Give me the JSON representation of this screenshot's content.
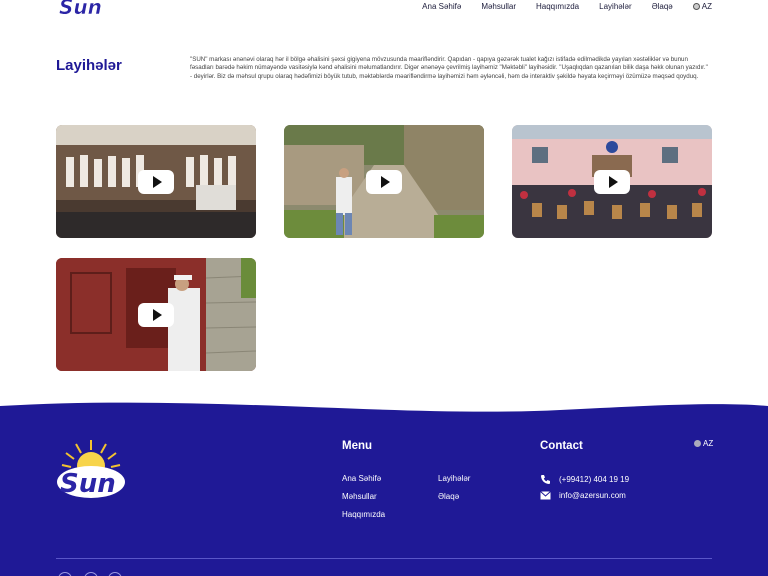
{
  "header": {
    "nav": [
      "Ana Səhifə",
      "Məhsullar",
      "Haqqımızda",
      "Layihələr",
      "Əlaqə"
    ],
    "lang": "AZ"
  },
  "main": {
    "title": "Layihələr",
    "intro": "\"SUN\" markası ənənəvi olaraq hər il bölgə əhalisini şəxsi gigiyena mövzusunda məarifləndirir. Qapıdan - qapıya gəzərək tualet kağızı istifadə edilmədikdə yayılan xəstəliklər və bunun fəsadları barədə həkim nümayəndə vasitəsiylə kənd əhalisini məlumatlandırır. Digər ənənəyə çevrilmiş layihəmiz \"Məktəbli\" layihəsidir. \"Uşaqlıqdan qazanılan bilik daşa həkk olunan yazıdır.\" - deyirlər. Biz də məhsul qrupu olaraq hədəfimizi böyük tutub, məktəblərdə məarifləndirmə layihəmizi həm əyləncəli, həm də interaktiv şəkildə həyata keçirməyi özümüzə məqsəd qoyduq."
  },
  "footer": {
    "menu_title": "Menu",
    "menu": [
      "Ana Səhifə",
      "Məhsullar",
      "Haqqımızda",
      "Layihələr",
      "Əlaqə"
    ],
    "contact_title": "Contact",
    "phone": "(+99412) 404 19 19",
    "email": "info@azersun.com",
    "lang": "AZ"
  },
  "colors": {
    "brand_blue": "#1f1996",
    "footer_bg": "#1f1996"
  },
  "icons": [
    "play-icon",
    "phone-icon",
    "mail-icon",
    "globe-icon"
  ]
}
